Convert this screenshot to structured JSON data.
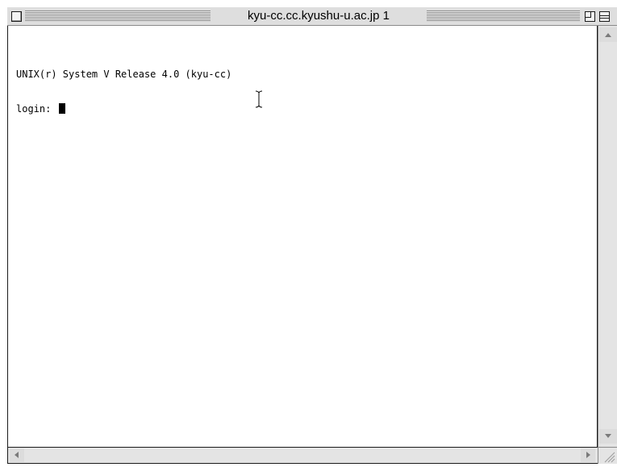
{
  "window": {
    "title": "kyu-cc.cc.kyushu-u.ac.jp 1"
  },
  "terminal": {
    "lines": [
      "UNIX(r) System V Release 4.0 (kyu-cc)",
      "login: "
    ]
  },
  "icons": {
    "close": "close-box-icon",
    "zoom": "zoom-box-icon",
    "collapse": "collapse-box-icon",
    "cursor": "text-ibeam-icon",
    "scroll_up": "arrow-up-icon",
    "scroll_down": "arrow-down-icon",
    "scroll_left": "arrow-left-icon",
    "scroll_right": "arrow-right-icon",
    "grow": "resize-grip-icon"
  },
  "colors": {
    "window_chrome": "#dcdcdc",
    "terminal_background": "#ffffff",
    "text": "#000000"
  }
}
